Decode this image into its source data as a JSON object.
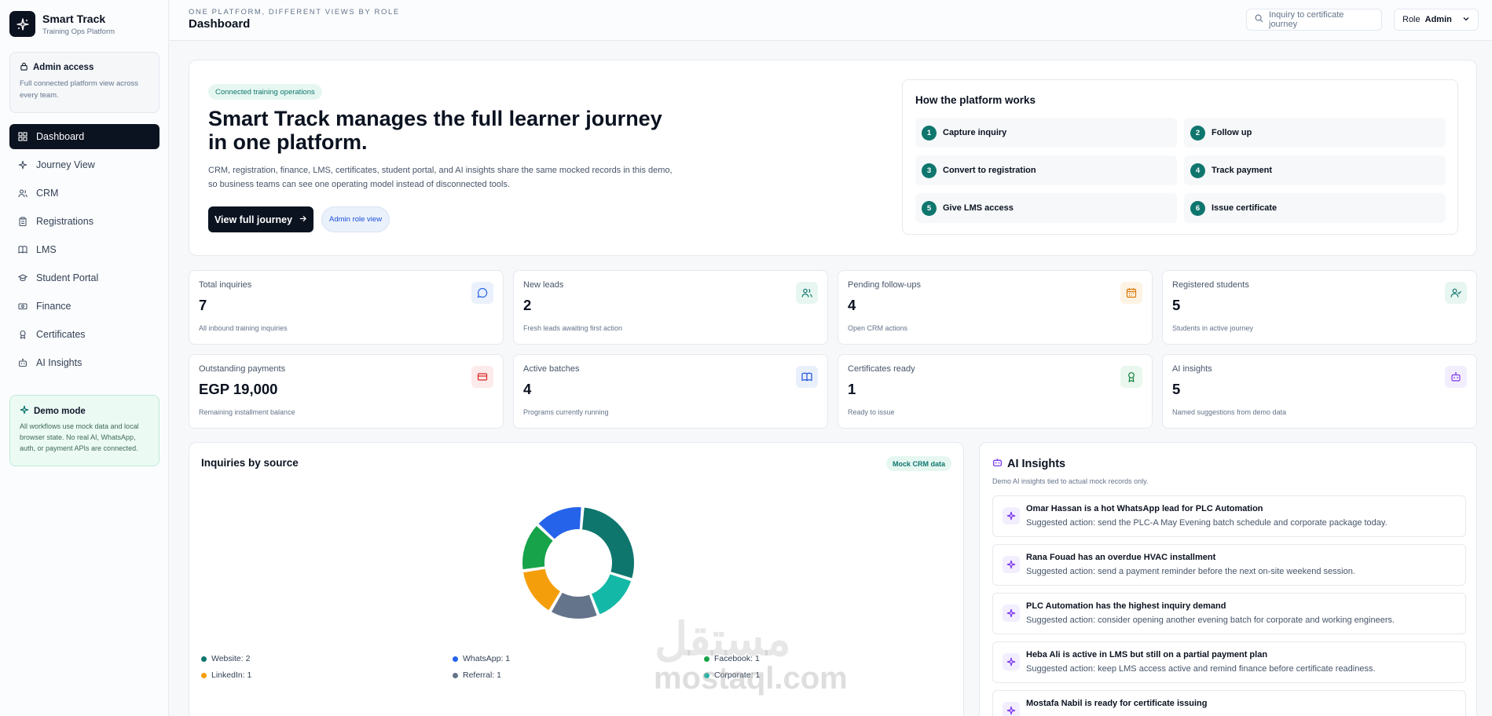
{
  "brand": {
    "name": "Smart Track",
    "subtitle": "Training Ops Platform"
  },
  "admin_card": {
    "title": "Admin access",
    "description": "Full connected platform view across every team."
  },
  "nav": [
    {
      "label": "Dashboard",
      "icon": "grid-icon",
      "active": true
    },
    {
      "label": "Journey View",
      "icon": "sparkle-icon",
      "active": false
    },
    {
      "label": "CRM",
      "icon": "users-icon",
      "active": false
    },
    {
      "label": "Registrations",
      "icon": "clipboard-icon",
      "active": false
    },
    {
      "label": "LMS",
      "icon": "book-icon",
      "active": false
    },
    {
      "label": "Student Portal",
      "icon": "graduation-cap-icon",
      "active": false
    },
    {
      "label": "Finance",
      "icon": "banknote-icon",
      "active": false
    },
    {
      "label": "Certificates",
      "icon": "award-icon",
      "active": false
    },
    {
      "label": "AI Insights",
      "icon": "bot-icon",
      "active": false
    }
  ],
  "demo_card": {
    "title": "Demo mode",
    "description": "All workflows use mock data and local browser state. No real AI, WhatsApp, auth, or payment APIs are connected."
  },
  "topbar": {
    "eyebrow": "ONE PLATFORM, DIFFERENT VIEWS BY ROLE",
    "title": "Dashboard",
    "search_placeholder": "Inquiry to certificate journey",
    "role_label": "Role",
    "role_value": "Admin"
  },
  "hero": {
    "badge": "Connected training operations",
    "title": "Smart Track manages the full learner journey in one platform.",
    "description": "CRM, registration, finance, LMS, certificates, student portal, and AI insights share the same mocked records in this demo, so business teams can see one operating model instead of disconnected tools.",
    "primary_button": "View full journey",
    "role_pill": "Admin role view"
  },
  "how_it_works": {
    "title": "How the platform works",
    "steps": [
      {
        "num": "1",
        "label": "Capture inquiry"
      },
      {
        "num": "2",
        "label": "Follow up"
      },
      {
        "num": "3",
        "label": "Convert to registration"
      },
      {
        "num": "4",
        "label": "Track payment"
      },
      {
        "num": "5",
        "label": "Give LMS access"
      },
      {
        "num": "6",
        "label": "Issue certificate"
      }
    ]
  },
  "stats": [
    {
      "label": "Total inquiries",
      "value": "7",
      "desc": "All inbound training inquiries",
      "icon": "message-icon",
      "color": "#2563eb",
      "bg": "#eaf1fd"
    },
    {
      "label": "New leads",
      "value": "2",
      "desc": "Fresh leads awaiting first action",
      "icon": "users-icon",
      "color": "#0f766e",
      "bg": "#e8f6f1"
    },
    {
      "label": "Pending follow-ups",
      "value": "4",
      "desc": "Open CRM actions",
      "icon": "calendar-icon",
      "color": "#d97706",
      "bg": "#fdf3e4"
    },
    {
      "label": "Registered students",
      "value": "5",
      "desc": "Students in active journey",
      "icon": "user-check-icon",
      "color": "#0f766e",
      "bg": "#e8f6f1"
    },
    {
      "label": "Outstanding payments",
      "value": "EGP 19,000",
      "desc": "Remaining installment balance",
      "icon": "credit-card-icon",
      "color": "#dc2626",
      "bg": "#fdeaea"
    },
    {
      "label": "Active batches",
      "value": "4",
      "desc": "Programs currently running",
      "icon": "book-open-icon",
      "color": "#1d4ed8",
      "bg": "#eaf0fb"
    },
    {
      "label": "Certificates ready",
      "value": "1",
      "desc": "Ready to issue",
      "icon": "award-icon",
      "color": "#15803d",
      "bg": "#e9f7ee"
    },
    {
      "label": "AI insights",
      "value": "5",
      "desc": "Named suggestions from demo data",
      "icon": "bot-icon",
      "color": "#7c3aed",
      "bg": "#f3eefe"
    }
  ],
  "chart": {
    "title": "Inquiries by source",
    "badge": "Mock CRM data"
  },
  "chart_data": {
    "type": "pie",
    "title": "Inquiries by source",
    "categories": [
      "Website",
      "WhatsApp",
      "Facebook",
      "LinkedIn",
      "Referral",
      "Corporate"
    ],
    "values": [
      2,
      1,
      1,
      1,
      1,
      1
    ],
    "colors": [
      "#0f766e",
      "#2563eb",
      "#16a34a",
      "#f59e0b",
      "#64748b",
      "#14b8a6"
    ],
    "legend_labels": [
      "Website: 2",
      "WhatsApp: 1",
      "Facebook: 1",
      "LinkedIn: 1",
      "Referral: 1",
      "Corporate: 1"
    ],
    "slice_order": [
      "Website",
      "Corporate",
      "Referral",
      "LinkedIn",
      "Facebook",
      "WhatsApp"
    ],
    "legend_placement": "bottom"
  },
  "ai_insights": {
    "title": "AI Insights",
    "subtitle": "Demo AI insights tied to actual mock records only.",
    "items": [
      {
        "title": "Omar Hassan is a hot WhatsApp lead for PLC Automation",
        "desc": "Suggested action: send the PLC-A May Evening batch schedule and corporate package today."
      },
      {
        "title": "Rana Fouad has an overdue HVAC installment",
        "desc": "Suggested action: send a payment reminder before the next on-site weekend session."
      },
      {
        "title": "PLC Automation has the highest inquiry demand",
        "desc": "Suggested action: consider opening another evening batch for corporate and working engineers."
      },
      {
        "title": "Heba Ali is active in LMS but still on a partial payment plan",
        "desc": "Suggested action: keep LMS access active and remind finance before certificate readiness."
      },
      {
        "title": "Mostafa Nabil is ready for certificate issuing",
        "desc": ""
      }
    ]
  },
  "watermark": {
    "arabic": "مستقل",
    "latin": "mostaql.com"
  }
}
